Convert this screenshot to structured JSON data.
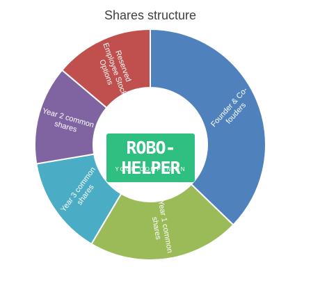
{
  "chart_data": {
    "type": "pie",
    "variant": "donut",
    "title": "Shares structure",
    "slices": [
      {
        "label": "Founder & Co-fouders",
        "label_lines": [
          "Founder & Co-",
          "fouders"
        ],
        "value": 35,
        "color": "#4f81bd"
      },
      {
        "label": "Year 1 common shares",
        "label_lines": [
          "Year 1 common",
          "shares"
        ],
        "value": 20,
        "color": "#9bbb59"
      },
      {
        "label": "Year 3 common shares",
        "label_lines": [
          "Year 3 common",
          "shares"
        ],
        "value": 13,
        "color": "#4bacc6"
      },
      {
        "label": "Year 2 common shares",
        "label_lines": [
          "Year 2 common",
          "shares"
        ],
        "value": 13,
        "color": "#8064a2"
      },
      {
        "label": "Reserved Employee Stock Options",
        "label_lines": [
          "Reserved",
          "Employee Stock",
          "Options"
        ],
        "value": 13,
        "color": "#c0504d"
      }
    ],
    "legend": "none"
  },
  "logo": {
    "name": "ROBO-HELPER",
    "tagline": "YOUR COMPANION",
    "color": "#2fbf80"
  }
}
